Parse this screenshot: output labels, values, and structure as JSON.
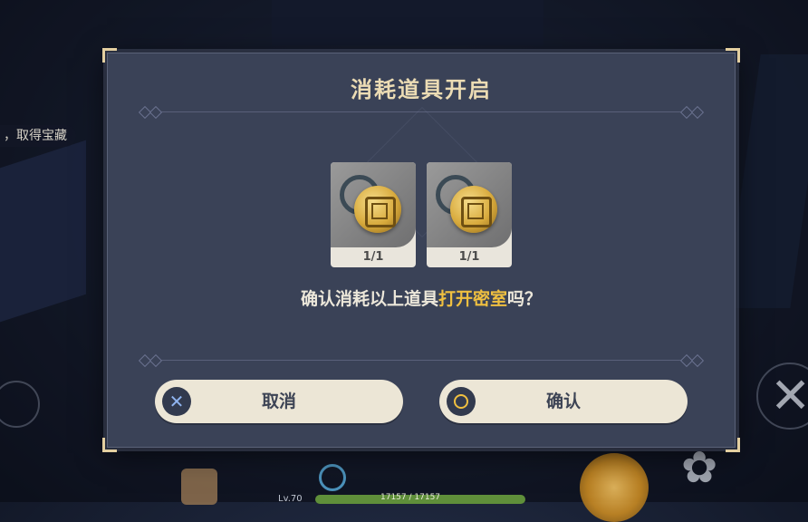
{
  "dialog": {
    "title": "消耗道具开启",
    "prompt_prefix": "确认消耗以上道具",
    "prompt_highlight": "打开密室",
    "prompt_suffix": "吗？",
    "items": [
      {
        "count": "1/1",
        "icon": "golden-maze-key-icon"
      },
      {
        "count": "1/1",
        "icon": "golden-maze-key-icon"
      }
    ],
    "buttons": {
      "cancel": {
        "label": "取消",
        "icon": "cross-icon"
      },
      "confirm": {
        "label": "确认",
        "icon": "circle-icon"
      }
    }
  },
  "hud": {
    "side_quest_text": "，取得宝藏",
    "level": "Lv.70",
    "hp": "17157 / 17157"
  },
  "colors": {
    "dialog_bg": "#3a4257",
    "title": "#ecdcb4",
    "highlight": "#f0c040",
    "button_bg": "#ece6d6"
  }
}
